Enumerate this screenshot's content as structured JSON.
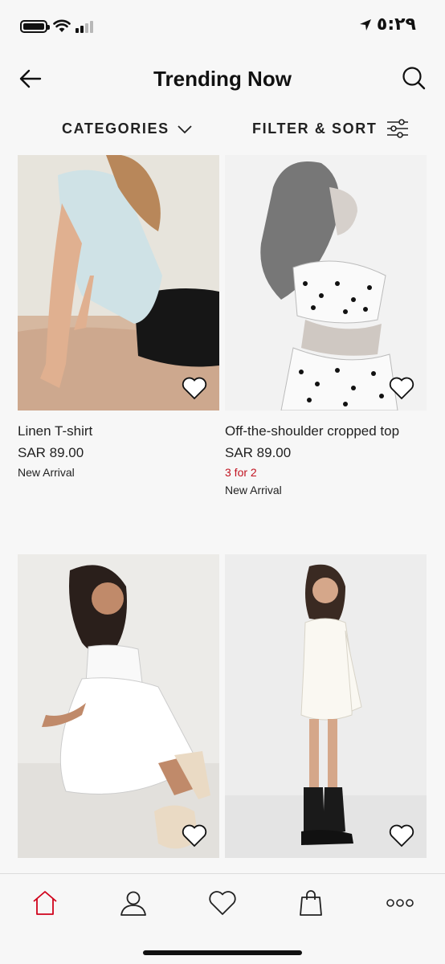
{
  "status_bar": {
    "time": "٥:٢٩",
    "icons": [
      "battery-icon",
      "wifi-icon",
      "cellular-signal-icon",
      "location-arrow-icon"
    ]
  },
  "header": {
    "title": "Trending Now",
    "back_icon": "arrow-left-icon",
    "search_icon": "search-icon"
  },
  "toolbar": {
    "categories_label": "CATEGORIES",
    "categories_icon": "chevron-down-icon",
    "filter_label": "FILTER & SORT",
    "filter_icon": "sliders-icon"
  },
  "products": [
    {
      "name": "Linen T-shirt",
      "price": "SAR 89.00",
      "promo": "",
      "badge": "New Arrival",
      "wishlisted": false
    },
    {
      "name": "Off-the-shoulder cropped top",
      "price": "SAR 89.00",
      "promo": "3 for 2",
      "badge": "New Arrival",
      "wishlisted": false
    },
    {
      "name": "",
      "price": "",
      "promo": "",
      "badge": "",
      "wishlisted": false
    },
    {
      "name": "",
      "price": "",
      "promo": "",
      "badge": "",
      "wishlisted": false
    }
  ],
  "tabbar": {
    "items": [
      {
        "icon": "home-icon",
        "active": true
      },
      {
        "icon": "user-icon",
        "active": false
      },
      {
        "icon": "heart-icon",
        "active": false
      },
      {
        "icon": "shopping-bag-icon",
        "active": false
      },
      {
        "icon": "more-icon",
        "active": false
      }
    ]
  },
  "colors": {
    "background": "#f7f7f7",
    "text": "#222222",
    "accent_red": "#c1121f",
    "active_tab": "#d0021b"
  }
}
